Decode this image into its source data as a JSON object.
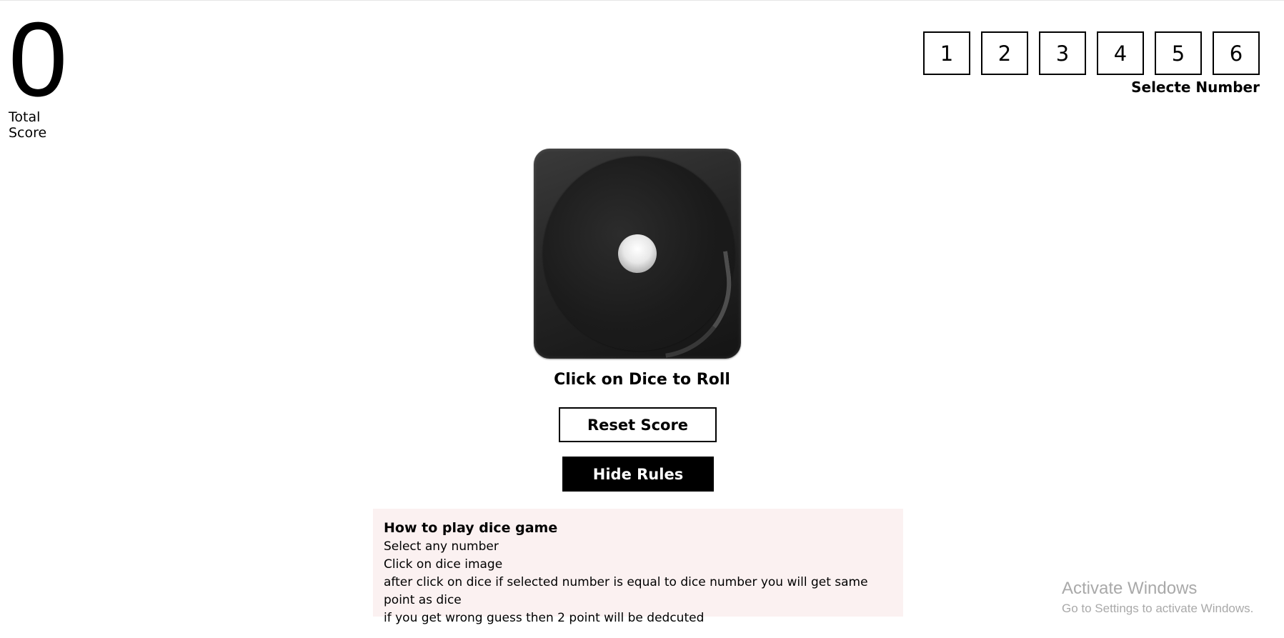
{
  "score": {
    "value": "0",
    "label": "Total Score"
  },
  "number_selector": {
    "numbers": [
      "1",
      "2",
      "3",
      "4",
      "5",
      "6"
    ],
    "label": "Selecte Number"
  },
  "dice": {
    "current_face": 1,
    "roll_instruction": "Click on Dice to Roll"
  },
  "buttons": {
    "reset": "Reset Score",
    "rules_toggle": "Hide Rules"
  },
  "rules": {
    "title": "How to play dice game",
    "lines": [
      "Select any number",
      "Click on dice image",
      "after click on dice if selected number is equal to dice number you will get same point as dice",
      "if you get wrong guess then 2 point will be dedcuted"
    ]
  },
  "watermark": {
    "title": "Activate Windows",
    "subtitle": "Go to Settings to activate Windows."
  }
}
